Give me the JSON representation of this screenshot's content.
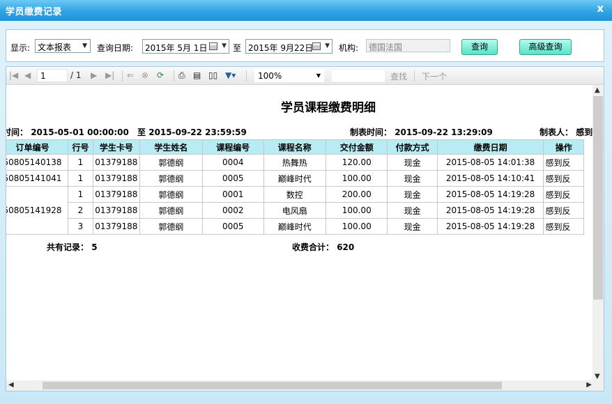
{
  "window": {
    "title": "学员缴费记录",
    "close": "x"
  },
  "filter": {
    "display_label": "显示:",
    "display_value": "文本报表",
    "date_label": "查询日期:",
    "date_from": "2015年 5月 1日",
    "to_label": "至",
    "date_to": "2015年 9月22日",
    "org_label": "机构:",
    "org_value": "德国法国",
    "query_button": "查询",
    "advanced_button": "高级查询"
  },
  "toolbar": {
    "page_current": "1",
    "page_total": "/ 1",
    "zoom": "100%",
    "find_label": "查找",
    "next_label": "下一个"
  },
  "report": {
    "title": "学员课程缴费明细",
    "period_label": "时间：",
    "period_from": "2015-05-01 00:00:00",
    "period_to_label": "至",
    "period_to": "2015-09-22 23:59:59",
    "made_time_label": "制表时间：",
    "made_time": "2015-09-22 13:29:09",
    "made_by_label": "制表人：",
    "made_by": "感到",
    "columns": [
      "订单编号",
      "行号",
      "学生卡号",
      "学生姓名",
      "课程编号",
      "课程名称",
      "交付金额",
      "付款方式",
      "缴费日期",
      "操作"
    ],
    "rows": [
      {
        "order": "50805140138",
        "line": "1",
        "card": "01379188",
        "name": "郭德纲",
        "course_no": "0004",
        "course_name": "热舞热",
        "amount": "120.00",
        "pay": "现金",
        "date": "2015-08-05 14:01:38",
        "op": "感到反"
      },
      {
        "order": "50805141041",
        "line": "1",
        "card": "01379188",
        "name": "郭德纲",
        "course_no": "0005",
        "course_name": "巅峰时代",
        "amount": "100.00",
        "pay": "现金",
        "date": "2015-08-05 14:10:41",
        "op": "感到反"
      },
      {
        "order": "50805141928",
        "line": "1",
        "card": "01379188",
        "name": "郭德纲",
        "course_no": "0001",
        "course_name": "数控",
        "amount": "200.00",
        "pay": "现金",
        "date": "2015-08-05 14:19:28",
        "op": "感到反"
      },
      {
        "order": "",
        "line": "2",
        "card": "01379188",
        "name": "郭德纲",
        "course_no": "0002",
        "course_name": "电风扇",
        "amount": "100.00",
        "pay": "现金",
        "date": "2015-08-05 14:19:28",
        "op": "感到反"
      },
      {
        "order": "",
        "line": "3",
        "card": "01379188",
        "name": "郭德纲",
        "course_no": "0005",
        "course_name": "巅峰时代",
        "amount": "100.00",
        "pay": "现金",
        "date": "2015-08-05 14:19:28",
        "op": "感到反"
      }
    ],
    "total_records_label": "共有记录：",
    "total_records": "5",
    "total_fee_label": "收费合计：",
    "total_fee": "620"
  }
}
